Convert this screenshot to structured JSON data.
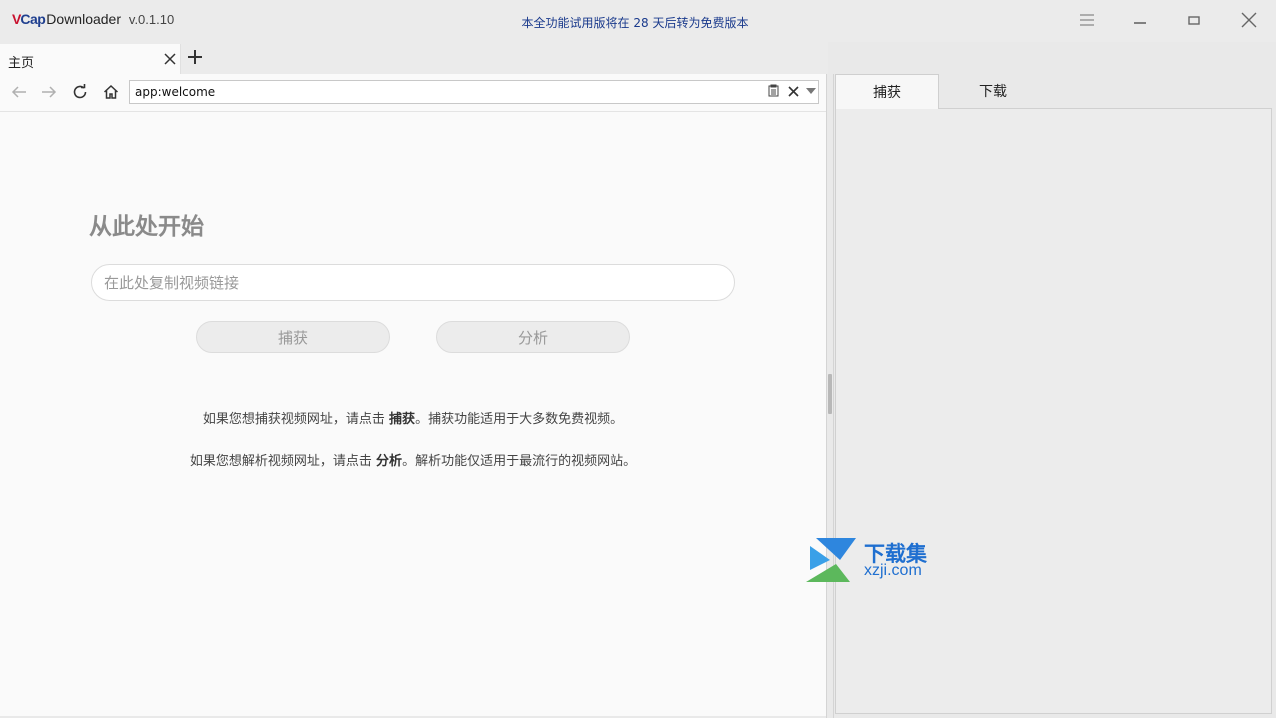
{
  "titlebar": {
    "logo_v": "V",
    "logo_cap": "Cap",
    "app_name": "Downloader",
    "version": "v.0.1.10",
    "trial_notice": "本全功能试用版将在 28 天后转为免费版本",
    "menu_icon": "hamburger-icon",
    "minimize_icon": "minimize-icon",
    "maximize_icon": "maximize-icon",
    "close_icon": "close-icon"
  },
  "tabs": {
    "items": [
      {
        "label": "主页",
        "active": true
      }
    ],
    "add_icon": "plus-icon"
  },
  "navbar": {
    "address": "app:welcome",
    "icons": [
      "back-arrow-icon",
      "forward-arrow-icon",
      "reload-icon",
      "home-icon",
      "clipboard-icon",
      "clear-icon",
      "dropdown-icon"
    ]
  },
  "welcome": {
    "heading": "从此处开始",
    "link_placeholder": "在此处复制视频链接",
    "capture_button": "捕获",
    "analyze_button": "分析",
    "help_capture": {
      "before": "如果您想捕获视频网址，请点击 ",
      "keyword": "捕获",
      "after": "。捕获功能适用于大多数免费视频。"
    },
    "help_analyze": {
      "before": "如果您想解析视频网址，请点击 ",
      "keyword": "分析",
      "after": "。解析功能仅适用于最流行的视频网站。"
    }
  },
  "right_panel": {
    "tabs": [
      {
        "label": "捕获",
        "active": true
      },
      {
        "label": "下载",
        "active": false
      }
    ]
  },
  "watermark": {
    "text_cn": "下载集",
    "text_en": "xzji.com",
    "colors": {
      "blue": "#1f6fd0",
      "green": "#5cb85c",
      "light_blue": "#3aa0e8"
    }
  },
  "colors": {
    "logo_red": "#c8102e",
    "logo_blue": "#1f3f8f",
    "notice_blue": "#1a3a8c",
    "heading_gray": "#8a8a8a"
  }
}
